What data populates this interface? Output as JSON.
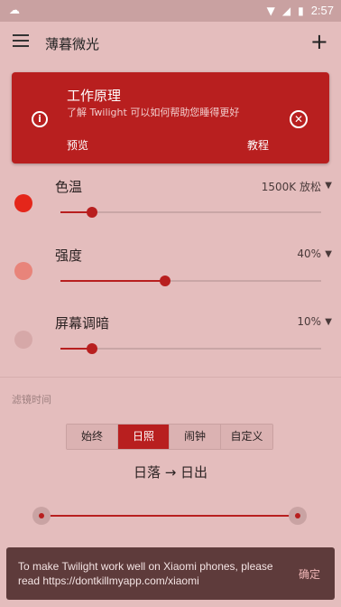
{
  "statusbar": {
    "time": "2:57"
  },
  "appbar": {
    "title": "薄暮微光"
  },
  "card": {
    "title": "工作原理",
    "subtitle": "了解 Twilight 可以如何帮助您睡得更好",
    "preview_label": "预览",
    "tutorial_label": "教程"
  },
  "settings": [
    {
      "label": "色温",
      "value": "1500K 放松",
      "level": 0.12,
      "dot_color": "#e4261a"
    },
    {
      "label": "强度",
      "value": "40%",
      "level": 0.4,
      "dot_color": "#e8847a"
    },
    {
      "label": "屏幕调暗",
      "value": "10%",
      "level": 0.12,
      "dot_color": "#d6a8a8"
    }
  ],
  "filter_time": {
    "label": "滤镜时间",
    "options": [
      "始终",
      "日照",
      "闹钟",
      "自定义"
    ],
    "selected": "日照",
    "mode_label": "日落 → 日出"
  },
  "colors": {
    "accent": "#b81f1f",
    "background": "#e4bdbd"
  },
  "snackbar": {
    "message": "To make Twilight work well on Xiaomi phones, please read https://dontkillmyapp.com/xiaomi",
    "action": "确定"
  }
}
